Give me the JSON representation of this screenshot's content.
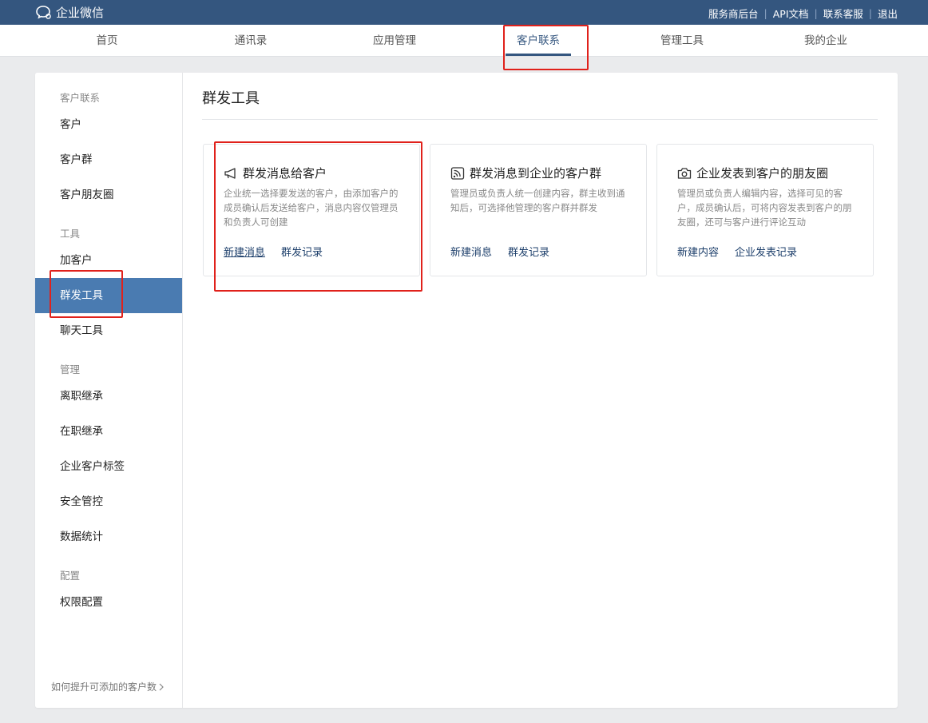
{
  "app": {
    "title": "企业微信"
  },
  "top_links": [
    "服务商后台",
    "API文档",
    "联系客服",
    "退出"
  ],
  "nav": {
    "items": [
      "首页",
      "通讯录",
      "应用管理",
      "客户联系",
      "管理工具",
      "我的企业"
    ],
    "active": "客户联系"
  },
  "sidebar": {
    "sections": [
      {
        "title": "客户联系",
        "items": [
          "客户",
          "客户群",
          "客户朋友圈"
        ]
      },
      {
        "title": "工具",
        "items": [
          "加客户",
          "群发工具",
          "聊天工具"
        ]
      },
      {
        "title": "管理",
        "items": [
          "离职继承",
          "在职继承",
          "企业客户标签",
          "安全管控",
          "数据统计"
        ]
      },
      {
        "title": "配置",
        "items": [
          "权限配置"
        ]
      }
    ],
    "active": "群发工具",
    "footer": "如何提升可添加的客户数"
  },
  "main": {
    "title": "群发工具",
    "cards": [
      {
        "icon": "megaphone-icon",
        "title": "群发消息给客户",
        "desc": "企业统一选择要发送的客户，由添加客户的成员确认后发送给客户，消息内容仅管理员和负责人可创建",
        "links": [
          "新建消息",
          "群发记录"
        ]
      },
      {
        "icon": "broadcast-icon",
        "title": "群发消息到企业的客户群",
        "desc": "管理员或负责人统一创建内容，群主收到通知后，可选择他管理的客户群并群发",
        "links": [
          "新建消息",
          "群发记录"
        ]
      },
      {
        "icon": "camera-icon",
        "title": "企业发表到客户的朋友圈",
        "desc": "管理员或负责人编辑内容，选择可见的客户，成员确认后，可将内容发表到客户的朋友圈，还可与客户进行评论互动",
        "links": [
          "新建内容",
          "企业发表记录"
        ]
      }
    ]
  },
  "colors": {
    "topbar": "#34567f",
    "active_sidebar": "#4a7bb1",
    "link": "#1d3f6b",
    "highlight_box": "#e0211b"
  }
}
